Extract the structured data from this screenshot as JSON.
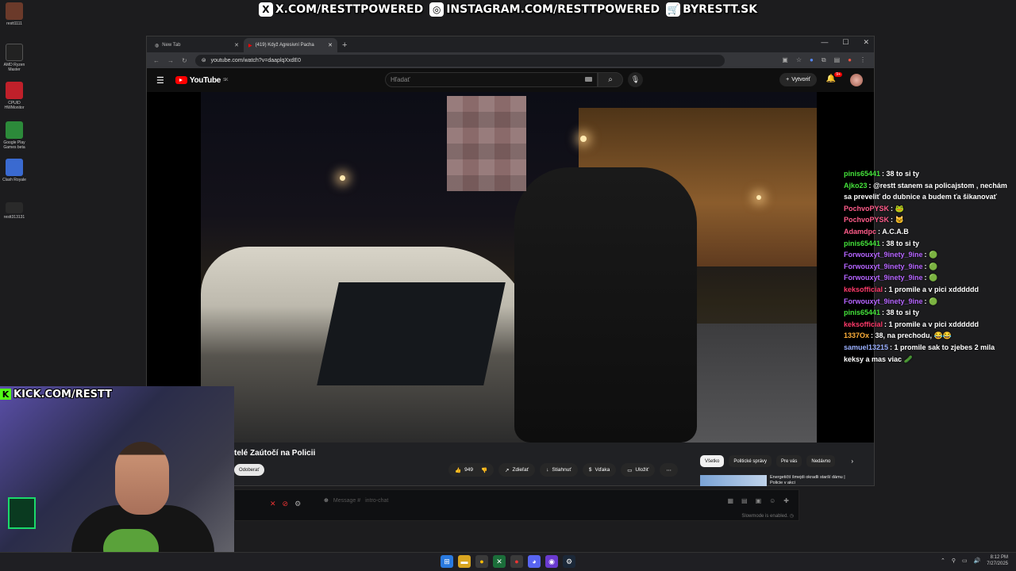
{
  "banner": [
    {
      "icon": "x-icon",
      "glyph": "X",
      "text": "X.COM/RESTTPOWERED"
    },
    {
      "icon": "instagram-icon",
      "glyph": "◎",
      "text": "INSTAGRAM.COM/RESTTPOWERED"
    },
    {
      "icon": "cart-icon",
      "glyph": "🛒",
      "text": "BYRESTT.SK"
    }
  ],
  "desktop": [
    {
      "label": "restt1111",
      "color": "#6b3a2a"
    },
    {
      "label": "AMD Ryzen Master",
      "color": "#222"
    },
    {
      "label": "CPUID HWMonitor",
      "color": "#c0202a"
    },
    {
      "label": "Google Play Games beta",
      "color": "#2c8a3a"
    },
    {
      "label": "Clash Royale",
      "color": "#3a6ad0"
    },
    {
      "label": "restt313131",
      "color": "#2a2a2a"
    }
  ],
  "browser": {
    "tabs": [
      {
        "label": "New Tab",
        "active": false
      },
      {
        "label": "(419) Když Agresivní Pacha",
        "active": true
      }
    ],
    "url": "youtube.com/watch?v=daaplqXxdE0"
  },
  "youtube": {
    "logo": "YouTube",
    "region": "SK",
    "search_placeholder": "Hľadať",
    "create_label": "Vytvoriť",
    "notif_count": "9+",
    "video_title": "telé Zaútočí na Policii",
    "subscribe_label": "Odoberať",
    "likes": "949",
    "actions": [
      {
        "icon": "share-icon",
        "glyph": "↗",
        "label": "Zdieľať"
      },
      {
        "icon": "download-icon",
        "glyph": "↓",
        "label": "Stiahnuť"
      },
      {
        "icon": "thanks-icon",
        "glyph": "$",
        "label": "Vďaka"
      },
      {
        "icon": "save-icon",
        "glyph": "▭",
        "label": "Uložiť"
      }
    ],
    "chips": [
      "Všetko",
      "Politické správy",
      "Pre vás",
      "Nedávno"
    ],
    "rec_title": "Energetičtí šmejdi okradli starší dámu | Policie v akci"
  },
  "chatbar": {
    "placeholder": "Message #",
    "channel": "intro-chat",
    "slowmode": "Slowmode is enabled."
  },
  "chat": [
    {
      "user": "pinis65441",
      "color": "#44e23a",
      "text": "38 to si ty"
    },
    {
      "user": "Ajko23",
      "color": "#44e23a",
      "text": "@restt stanem sa policajstom , nechám sa preveliť do dubnice a budem ťa šikanovať"
    },
    {
      "user": "PochvoPYSK",
      "color": "#ff5c8a",
      "text": "🐸"
    },
    {
      "user": "PochvoPYSK",
      "color": "#ff5c8a",
      "text": "🐱"
    },
    {
      "user": "Adamdpc",
      "color": "#ff5c8a",
      "text": "A.C.A.B"
    },
    {
      "user": "pinis65441",
      "color": "#44e23a",
      "text": "38 to si ty"
    },
    {
      "user": "Forwouxyt_9inety_9ine",
      "color": "#b564ff",
      "text": "🟢"
    },
    {
      "user": "Forwouxyt_9inety_9ine",
      "color": "#b564ff",
      "text": "🟢"
    },
    {
      "user": "Forwouxyt_9inety_9ine",
      "color": "#b564ff",
      "text": "🟢"
    },
    {
      "user": "keksofficial",
      "color": "#ff3a6a",
      "text": "1 promile a v pici xdddddd"
    },
    {
      "user": "Forwouxyt_9inety_9ine",
      "color": "#b564ff",
      "text": "🟢"
    },
    {
      "user": "pinis65441",
      "color": "#44e23a",
      "text": "38 to si ty"
    },
    {
      "user": "keksofficial",
      "color": "#ff3a6a",
      "text": "1 promile a v pici xdddddd"
    },
    {
      "user": "1337Ox",
      "color": "#ffb03a",
      "text": "38, na prechodu, 😂😂"
    },
    {
      "user": "samuel13215",
      "color": "#9ab0ff",
      "text": "1 promile sak to zjebes 2 mila keksy a mas viac 🥒"
    }
  ],
  "kick": "KICK.COM/RESTT",
  "taskbar": {
    "time": "8:12 PM",
    "date": "7/27/2025"
  }
}
